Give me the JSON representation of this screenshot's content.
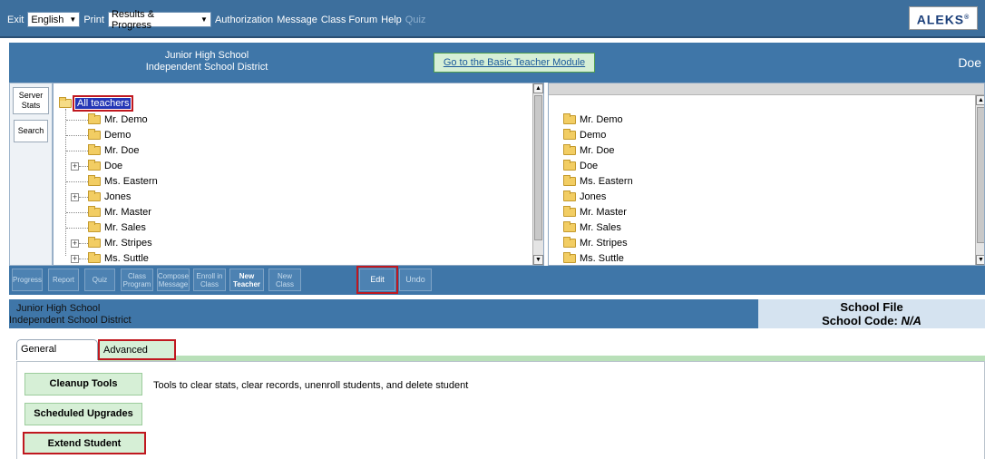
{
  "menu": {
    "exit": "Exit",
    "language": "English",
    "print": "Print",
    "report_select": "Results & Progress",
    "authorization": "Authorization",
    "message": "Message",
    "class_forum": "Class Forum",
    "help": "Help",
    "quiz": "Quiz",
    "logo": "ALEKS"
  },
  "school": {
    "name_line1": "Junior High School",
    "name_line2": "Independent School District",
    "basic_link": "Go to the Basic Teacher Module",
    "user": "Doe"
  },
  "side_buttons": {
    "server_stats": "Server Stats",
    "search": "Search"
  },
  "tree": {
    "root": "All teachers",
    "items": [
      "Mr. Demo",
      "Demo",
      "Mr. Doe",
      "Doe",
      "Ms. Eastern",
      "Jones",
      "Mr. Master",
      "Mr. Sales",
      "Mr. Stripes",
      "Ms. Suttle"
    ]
  },
  "right_list": [
    "Mr. Demo",
    "Demo",
    "Mr. Doe",
    "Doe",
    "Ms. Eastern",
    "Jones",
    "Mr. Master",
    "Mr. Sales",
    "Mr. Stripes",
    "Ms. Suttle"
  ],
  "toolbar": {
    "progress": "Progress",
    "report": "Report",
    "quiz": "Quiz",
    "class_program": "Class Program",
    "compose_message": "Compose Message",
    "enroll_in_class": "Enroll in Class",
    "new_teacher": "New Teacher",
    "new_class": "New Class",
    "edit": "Edit",
    "undo": "Undo"
  },
  "file_header": {
    "name_line1": "Junior High School",
    "name_line2": "Independent School District",
    "title": "School File",
    "code_label": "School Code:",
    "code_value": "N/A"
  },
  "tabs": {
    "general": "General",
    "advanced": "Advanced"
  },
  "advanced": {
    "cleanup_tools": "Cleanup Tools",
    "cleanup_desc": "Tools to clear stats, clear records, unenroll students, and delete student",
    "scheduled_upgrades": "Scheduled Upgrades",
    "extend_accounts": "Extend Student Accounts"
  }
}
